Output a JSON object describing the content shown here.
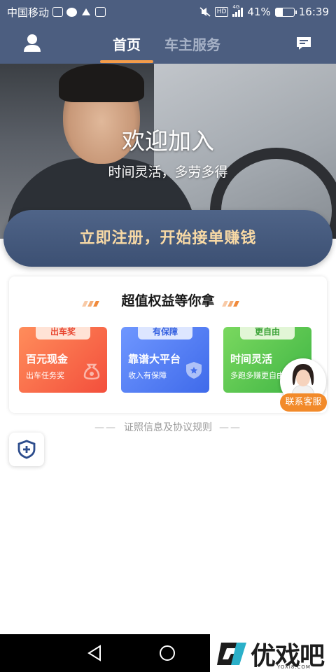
{
  "status_bar": {
    "carrier": "中国移动",
    "network": "4G",
    "hd": "HD",
    "battery": "41%",
    "battery_level": 0.41,
    "time": "16:39"
  },
  "header": {
    "tabs": [
      {
        "label": "首页",
        "active": true
      },
      {
        "label": "车主服务",
        "active": false
      }
    ],
    "accent_color": "#f39c4a",
    "bg_color": "#4c5e80"
  },
  "banner": {
    "title": "欢迎加入",
    "subtitle": "时间灵活，多劳多得"
  },
  "register_button": {
    "label": "立即注册，开始接单赚钱"
  },
  "benefits": {
    "title": "超值权益等你拿",
    "items": [
      {
        "tag": "出车奖",
        "title": "百元现金",
        "desc": "出车任务奖",
        "color": "#f34f3c"
      },
      {
        "tag": "有保障",
        "title": "靠谱大平台",
        "desc": "收入有保障",
        "color": "#3f6aea"
      },
      {
        "tag": "更自由",
        "title": "时间灵活",
        "desc": "多跑多赚更自由",
        "color": "#3fb544"
      }
    ]
  },
  "customer_service": {
    "label": "联系客服"
  },
  "license": {
    "dash": "——",
    "label": "证照信息及协议规则"
  },
  "watermark": {
    "text": "优戏吧",
    "url": "YOXI8.COM"
  }
}
